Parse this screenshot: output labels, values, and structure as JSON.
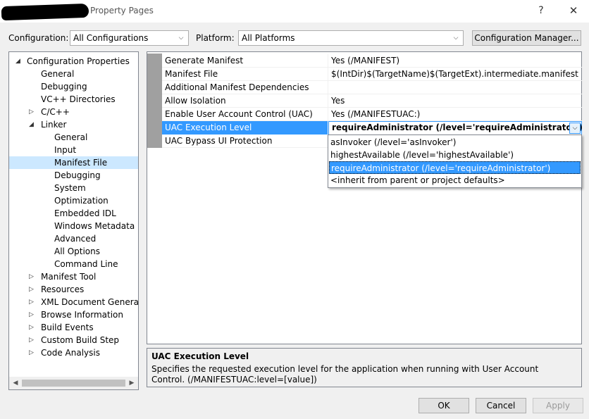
{
  "window": {
    "title": "Property Pages",
    "help_glyph": "?",
    "close_glyph": "✕"
  },
  "config_bar": {
    "configuration_label": "Configuration:",
    "configuration_value": "All Configurations",
    "platform_label": "Platform:",
    "platform_value": "All Platforms",
    "config_manager_label": "Configuration Manager..."
  },
  "tree": {
    "items": [
      {
        "label": "Configuration Properties",
        "expander": "◢"
      },
      {
        "label": "General",
        "expander": ""
      },
      {
        "label": "Debugging",
        "expander": ""
      },
      {
        "label": "VC++ Directories",
        "expander": ""
      },
      {
        "label": "C/C++",
        "expander": "▷"
      },
      {
        "label": "Linker",
        "expander": "◢"
      },
      {
        "label": "General",
        "expander": ""
      },
      {
        "label": "Input",
        "expander": ""
      },
      {
        "label": "Manifest File",
        "expander": ""
      },
      {
        "label": "Debugging",
        "expander": ""
      },
      {
        "label": "System",
        "expander": ""
      },
      {
        "label": "Optimization",
        "expander": ""
      },
      {
        "label": "Embedded IDL",
        "expander": ""
      },
      {
        "label": "Windows Metadata",
        "expander": ""
      },
      {
        "label": "Advanced",
        "expander": ""
      },
      {
        "label": "All Options",
        "expander": ""
      },
      {
        "label": "Command Line",
        "expander": ""
      },
      {
        "label": "Manifest Tool",
        "expander": "▷"
      },
      {
        "label": "Resources",
        "expander": "▷"
      },
      {
        "label": "XML Document Generator",
        "expander": "▷"
      },
      {
        "label": "Browse Information",
        "expander": "▷"
      },
      {
        "label": "Build Events",
        "expander": "▷"
      },
      {
        "label": "Custom Build Step",
        "expander": "▷"
      },
      {
        "label": "Code Analysis",
        "expander": "▷"
      }
    ]
  },
  "grid": {
    "rows": [
      {
        "name": "Generate Manifest",
        "value": "Yes (/MANIFEST)"
      },
      {
        "name": "Manifest File",
        "value": "$(IntDir)$(TargetName)$(TargetExt).intermediate.manifest"
      },
      {
        "name": "Additional Manifest Dependencies",
        "value": ""
      },
      {
        "name": "Allow Isolation",
        "value": "Yes"
      },
      {
        "name": "Enable User Account Control (UAC)",
        "value": "Yes (/MANIFESTUAC:)"
      },
      {
        "name": "UAC Execution Level",
        "value": "requireAdministrator (/level='requireAdministrator')"
      },
      {
        "name": "UAC Bypass UI Protection",
        "value": ""
      }
    ],
    "dropdown_options": [
      "asInvoker (/level='asInvoker')",
      "highestAvailable (/level='highestAvailable')",
      "requireAdministrator (/level='requireAdministrator')",
      "<inherit from parent or project defaults>"
    ]
  },
  "description": {
    "title": "UAC Execution Level",
    "body": "Specifies the requested execution level for the application when running with User Account Control. (/MANIFESTUAC:level=[value])"
  },
  "buttons": {
    "ok": "OK",
    "cancel": "Cancel",
    "apply": "Apply"
  },
  "colors": {
    "selection_blue": "#3399ff",
    "tree_selection": "#cce8ff",
    "margin_gray": "#a0a0a0"
  }
}
